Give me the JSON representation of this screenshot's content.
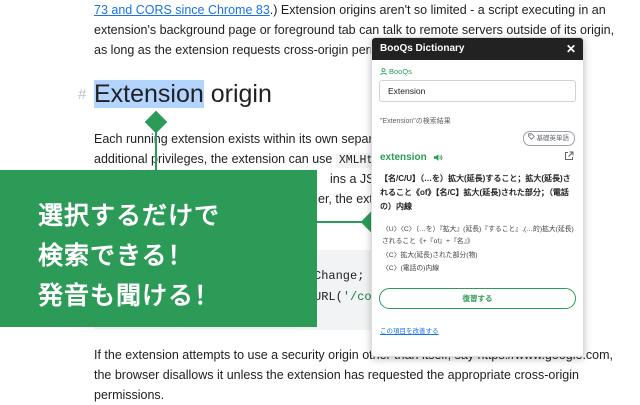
{
  "article": {
    "line1_link": "73 and CORS since Chrome 83",
    "line1_rest": ".) Extension origins aren't so limited - a script executing in an",
    "line2": "extension's background page or foreground tab can talk to remote servers outside of its origin,",
    "line3": "as long as the extension requests cross-origin permissions.",
    "heading_hash": "#",
    "heading_selected": "Extension",
    "heading_rest": " origin",
    "para1_line1": "Each running extension exists within its own separate secu",
    "para1_line2_a": "additional privileges, the extension can use ",
    "para1_line2_code": "XMLHttpRequ",
    "para1_line3": "ins a JSON o",
    "para1_line4": "er, the exten",
    "code_line1_a": "Change; ",
    "code_line1_b": "//",
    "code_line2_a": "URL(",
    "code_line2_b": "'/conf",
    "para2_line1": "If the extension attempts to use a security origin other than itself, say https://www.google.com,",
    "para2_line2": "the browser disallows it unless the extension has requested the appropriate cross-origin",
    "para2_line3": "permissions."
  },
  "banner": {
    "line1": "選択するだけで",
    "line2": "検索できる！",
    "line3": "発音も聞ける！"
  },
  "popup": {
    "title": "BooQs Dictionary",
    "close": "✕",
    "brand": "BooQs",
    "search_value": "Extension",
    "result_label": "\"Extension\"の検索結果",
    "tag": "基礎英単語",
    "word": "extension",
    "definition": "【名/C/U】（…を）拡大(延長)すること；拡大(延長)されること《of》【名/C】拡大(延長)された部分；（電話の）内線",
    "sub1": "〈U〉〈C〉（…を）『拡大』(延長)『すること』,(…的)拡大(延長)されること《+『of』+『名』》",
    "sub2": "〈C〉拡大(延長)された部分(物)",
    "sub3": "〈C〉(電話の)内線",
    "review_button": "復習する",
    "improve_link": "この項目を改善する"
  },
  "colors": {
    "accent_green": "#2b9b57",
    "header_dark": "#222222",
    "link_blue": "#1a73e8",
    "selection": "#b3d4fc"
  },
  "icons": {
    "speaker": "speaker-icon",
    "external": "external-link-icon",
    "tag": "tag-icon",
    "brand": "person-icon"
  }
}
